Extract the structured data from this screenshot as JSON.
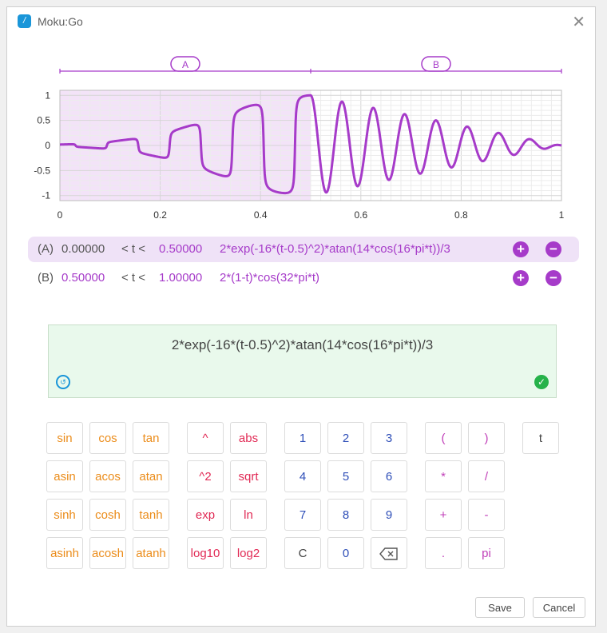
{
  "window": {
    "title": "Moku:Go",
    "close_glyph": "✕"
  },
  "chart_data": {
    "type": "line",
    "segments": [
      {
        "label": "A",
        "start": 0,
        "end": 0.5,
        "expr": "2*exp(-16*(t-0.5)^2)*atan(14*cos(16*pi*t))/3"
      },
      {
        "label": "B",
        "start": 0.5,
        "end": 1,
        "expr": "2*(1-t)*cos(32*pi*t)"
      }
    ],
    "x_ticks": [
      "0",
      "0.2",
      "0.4",
      "0.6",
      "0.8",
      "1"
    ],
    "y_ticks": [
      "1",
      "0.5",
      "0",
      "-0.5",
      "-1"
    ],
    "xlim": [
      0,
      1
    ],
    "ylim": [
      -1.1,
      1.1
    ],
    "grid": true,
    "highlighted_segment": "A",
    "line_color": "#a63bc9",
    "highlight_color": "#f3e3f8"
  },
  "segments": [
    {
      "label": "(A)",
      "start": "0.00000",
      "op": "< t <",
      "end": "0.50000",
      "expr": "2*exp(-16*(t-0.5)^2)*atan(14*cos(16*pi*t))/3"
    },
    {
      "label": "(B)",
      "start": "0.50000",
      "op": "< t <",
      "end": "1.00000",
      "expr": "2*(1-t)*cos(32*pi*t)"
    }
  ],
  "editor": {
    "expression": "2*exp(-16*(t-0.5)^2)*atan(14*cos(16*pi*t))/3"
  },
  "keys": {
    "trig": [
      "sin",
      "cos",
      "tan",
      "asin",
      "acos",
      "atan",
      "sinh",
      "cosh",
      "tanh",
      "asinh",
      "acosh",
      "atanh"
    ],
    "funcs": [
      "^",
      "abs",
      "^2",
      "sqrt",
      "exp",
      "ln",
      "log10",
      "log2"
    ],
    "digits": [
      "1",
      "2",
      "3",
      "4",
      "5",
      "6",
      "7",
      "8",
      "9",
      "C",
      "0"
    ],
    "ops": [
      "(",
      ")",
      "*",
      "/",
      "+",
      "-",
      ".",
      "pi"
    ],
    "var": "t"
  },
  "buttons": {
    "save": "Save",
    "cancel": "Cancel"
  },
  "colors": {
    "accent": "#a63bc9",
    "orange": "#eb8c1a",
    "red": "#e12a55",
    "blue": "#2f4fb8",
    "ok": "#26b24a"
  }
}
